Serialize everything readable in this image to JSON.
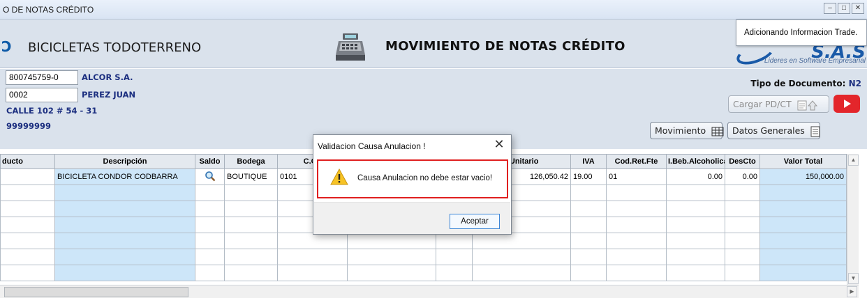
{
  "window": {
    "title": "O DE NOTAS CRÉDITO"
  },
  "header": {
    "company": "BICICLETAS TODOTERRENO",
    "title": "MOVIMIENTO DE NOTAS CRÉDITO",
    "left_logo_text": "Ɔ",
    "brand": {
      "name": "S.A.S",
      "tagline": "Lideres en Software Empresarial"
    }
  },
  "toast": {
    "text": "Adicionando Informacion  Trade."
  },
  "form": {
    "nit": "800745759-0",
    "client_name": "ALCOR S.A.",
    "seller_code": "0002",
    "seller_name": "PEREZ JUAN",
    "address": "CALLE 102 # 54 - 31",
    "phone": "99999999",
    "doc_type_label": "Tipo de Documento:",
    "doc_type_value": "N2",
    "cargar_label": "Cargar PD/CT",
    "movimiento_label": "Movimiento",
    "datos_generales_label": "Datos Generales"
  },
  "grid": {
    "columns": [
      "ducto",
      "Descripción",
      "Saldo",
      "Bodega",
      "C.Co",
      "",
      "",
      "r Unitario",
      "IVA",
      "Cod.Ret.Fte",
      "I.Beb.Alcoholica",
      "DesCto",
      "Valor Total"
    ],
    "rows": [
      [
        "",
        "BICICLETA CONDOR CODBARRA",
        "",
        "BOUTIQUE",
        "0101",
        "",
        "",
        "126,050.42",
        "19.00",
        "01",
        "0.00",
        "0.00",
        "150,000.00"
      ]
    ]
  },
  "dialog": {
    "title": "Validacion Causa Anulacion !",
    "message": "Causa Anulacion no debe estar vacio!",
    "ok_label": "Aceptar",
    "close_glyph": "✕"
  },
  "colors": {
    "accent_blue": "#1c2f80",
    "error_red": "#e01f1f",
    "grid_blue": "#cde6f9",
    "form_bg": "#dae2ec"
  }
}
